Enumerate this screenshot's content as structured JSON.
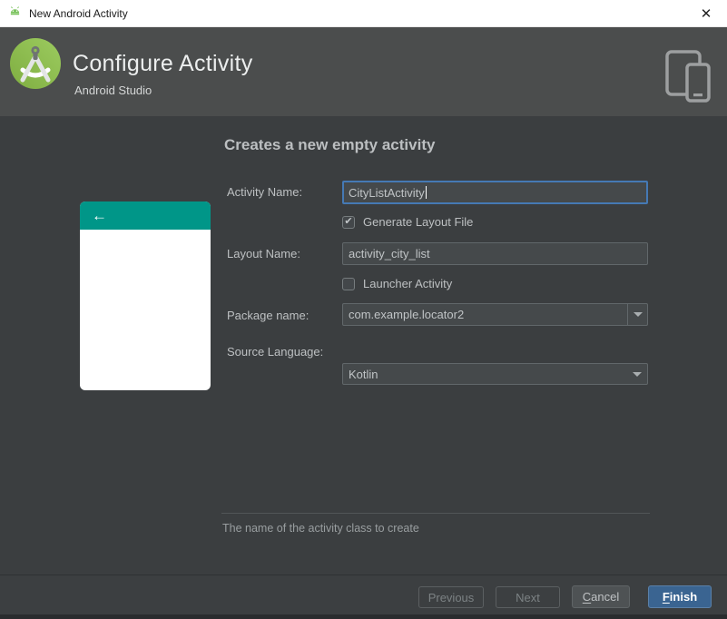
{
  "titlebar": {
    "title": "New Android Activity"
  },
  "header": {
    "title": "Configure Activity",
    "subtitle": "Android Studio"
  },
  "main": {
    "heading": "Creates a new empty activity",
    "preview": {
      "back_arrow": "←"
    },
    "form": {
      "activity_name_label": "Activity Name:",
      "activity_name_value": "CityListActivity",
      "generate_layout_label": "Generate Layout File",
      "generate_layout_checked": true,
      "layout_name_label": "Layout Name:",
      "layout_name_value": "activity_city_list",
      "launcher_label": "Launcher Activity",
      "launcher_checked": false,
      "package_label": "Package name:",
      "package_value": "com.example.locator2",
      "language_label": "Source Language:",
      "language_value": "Kotlin"
    },
    "hint": "The name of the activity class to create"
  },
  "footer": {
    "previous": "Previous",
    "next": "Next",
    "cancel_mn": "C",
    "cancel_rest": "ancel",
    "finish_mn": "F",
    "finish_rest": "inish"
  },
  "icons": {
    "close": "✕",
    "check": "✔"
  },
  "colors": {
    "accent_teal": "#009688",
    "focus_blue": "#4579b4",
    "finish_blue": "#3a6491",
    "android_green": "#8bc34a",
    "header_gray": "#4b4d4d",
    "panel_gray": "#3b3e40"
  }
}
